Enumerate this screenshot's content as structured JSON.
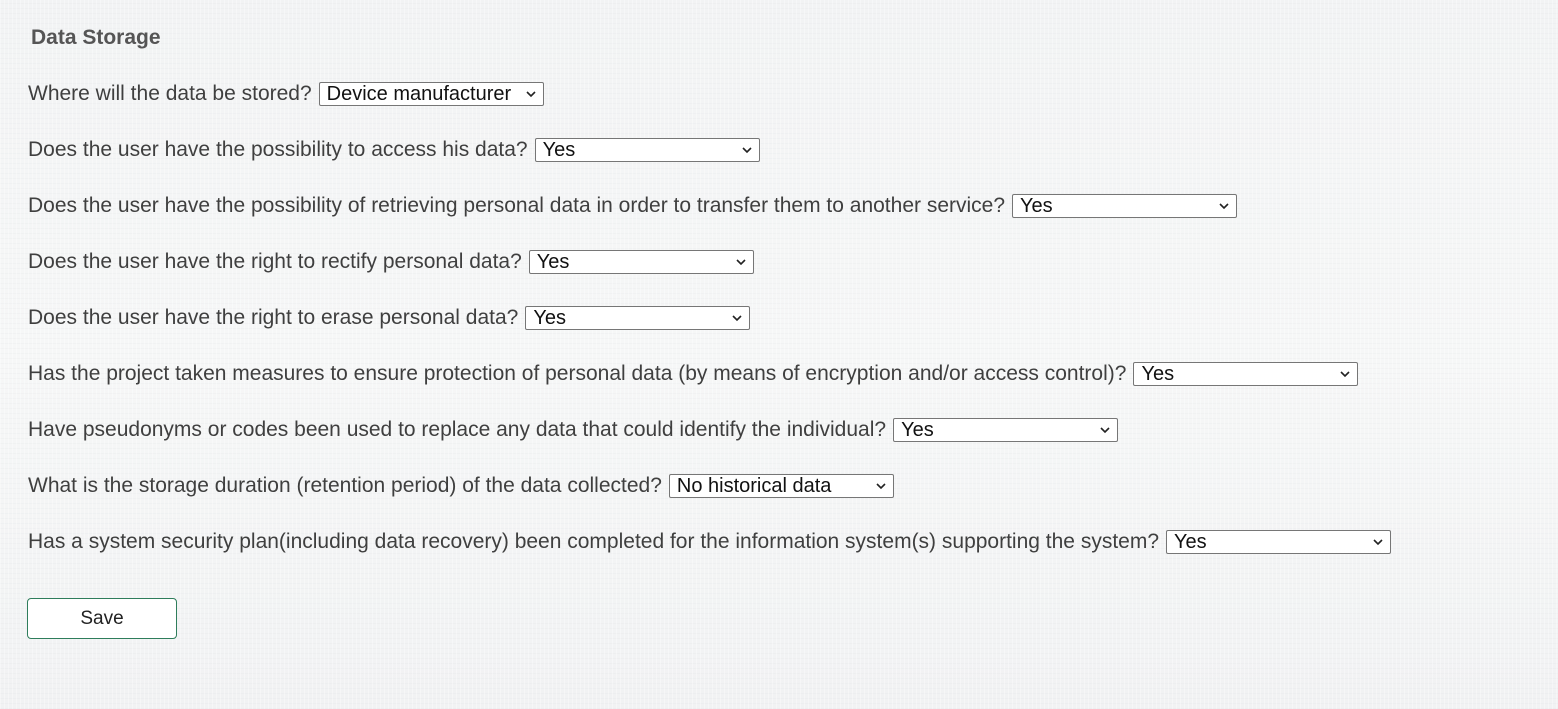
{
  "section": {
    "title": "Data Storage"
  },
  "questions": [
    {
      "label": "Where will the data be stored?",
      "value": "Device manufacturer"
    },
    {
      "label": "Does the user have the possibility to access his data?",
      "value": "Yes"
    },
    {
      "label": "Does the user have the possibility of retrieving personal data in order to transfer them to another service?",
      "value": "Yes"
    },
    {
      "label": "Does the user have the right to rectify personal data?",
      "value": "Yes"
    },
    {
      "label": "Does the user have the right to erase personal data?",
      "value": "Yes"
    },
    {
      "label": "Has the project taken measures to ensure protection of personal data (by means of encryption and/or access control)?",
      "value": "Yes"
    },
    {
      "label": "Have pseudonyms or codes been used to replace any data that could identify the individual?",
      "value": "Yes"
    },
    {
      "label": "What is the storage duration (retention period) of the data collected?",
      "value": "No historical data"
    },
    {
      "label": "Has a system security plan(including data recovery) been completed for the information system(s) supporting the system?",
      "value": "Yes"
    }
  ],
  "actions": {
    "save_label": "Save"
  },
  "colors": {
    "button_border": "#2e7d5b",
    "title_text": "#555555",
    "label_text": "#3f3f3f"
  }
}
